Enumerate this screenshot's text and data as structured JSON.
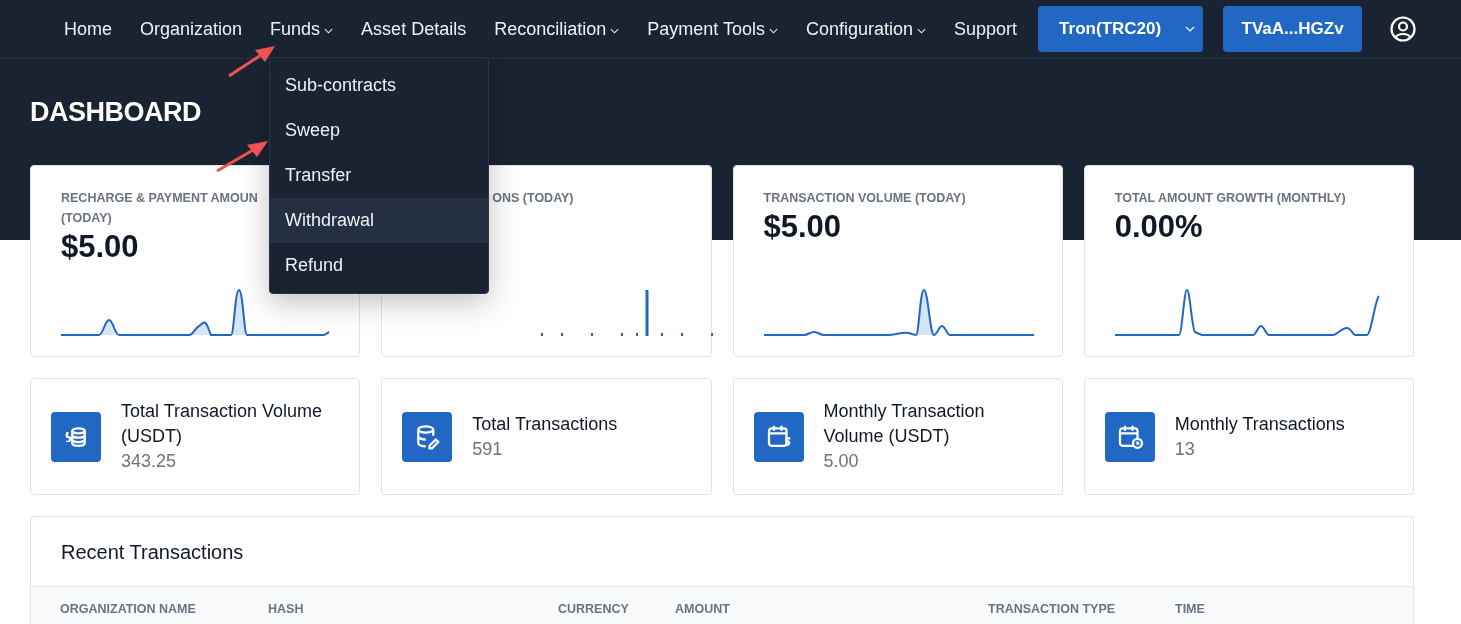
{
  "nav": {
    "items": [
      {
        "label": "Home",
        "has_menu": false
      },
      {
        "label": "Organization",
        "has_menu": false
      },
      {
        "label": "Funds",
        "has_menu": true
      },
      {
        "label": "Asset Details",
        "has_menu": false
      },
      {
        "label": "Reconciliation",
        "has_menu": true
      },
      {
        "label": "Payment Tools",
        "has_menu": true
      },
      {
        "label": "Configuration",
        "has_menu": true
      },
      {
        "label": "Support",
        "has_menu": false
      }
    ],
    "network_button": "Tron(TRC20)",
    "wallet_button": "TVaA...HGZv"
  },
  "funds_menu": [
    {
      "label": "Sub-contracts",
      "highlighted": false
    },
    {
      "label": "Sweep",
      "highlighted": false
    },
    {
      "label": "Transfer",
      "highlighted": false
    },
    {
      "label": "Withdrawal",
      "highlighted": true
    },
    {
      "label": "Refund",
      "highlighted": false
    }
  ],
  "page_title": "DASHBOARD",
  "stat_cards": [
    {
      "kind": "full",
      "title_lines": [
        "RECHARGE & PAYMENT AMOUN",
        "(TODAY)"
      ],
      "value": "$5.00"
    },
    {
      "kind": "covered",
      "title_lines": [
        "ONS (TODAY)"
      ]
    },
    {
      "kind": "full",
      "title_lines": [
        "TRANSACTION VOLUME (TODAY)"
      ],
      "value": "$5.00"
    },
    {
      "kind": "full",
      "title_lines": [
        "TOTAL AMOUNT GROWTH (MONTHLY)"
      ],
      "value": "0.00%"
    }
  ],
  "summary_cards": [
    {
      "label": "Total Transaction Volume (USDT)",
      "value": "343.25"
    },
    {
      "label": "Total Transactions",
      "value": "591"
    },
    {
      "label": "Monthly Transaction Volume (USDT)",
      "value": "5.00"
    },
    {
      "label": "Monthly Transactions",
      "value": "13"
    }
  ],
  "recent_transactions": {
    "title": "Recent Transactions",
    "columns": [
      "ORGANIZATION NAME",
      "HASH",
      "CURRENCY",
      "AMOUNT",
      "TRANSACTION TYPE",
      "TIME"
    ]
  }
}
